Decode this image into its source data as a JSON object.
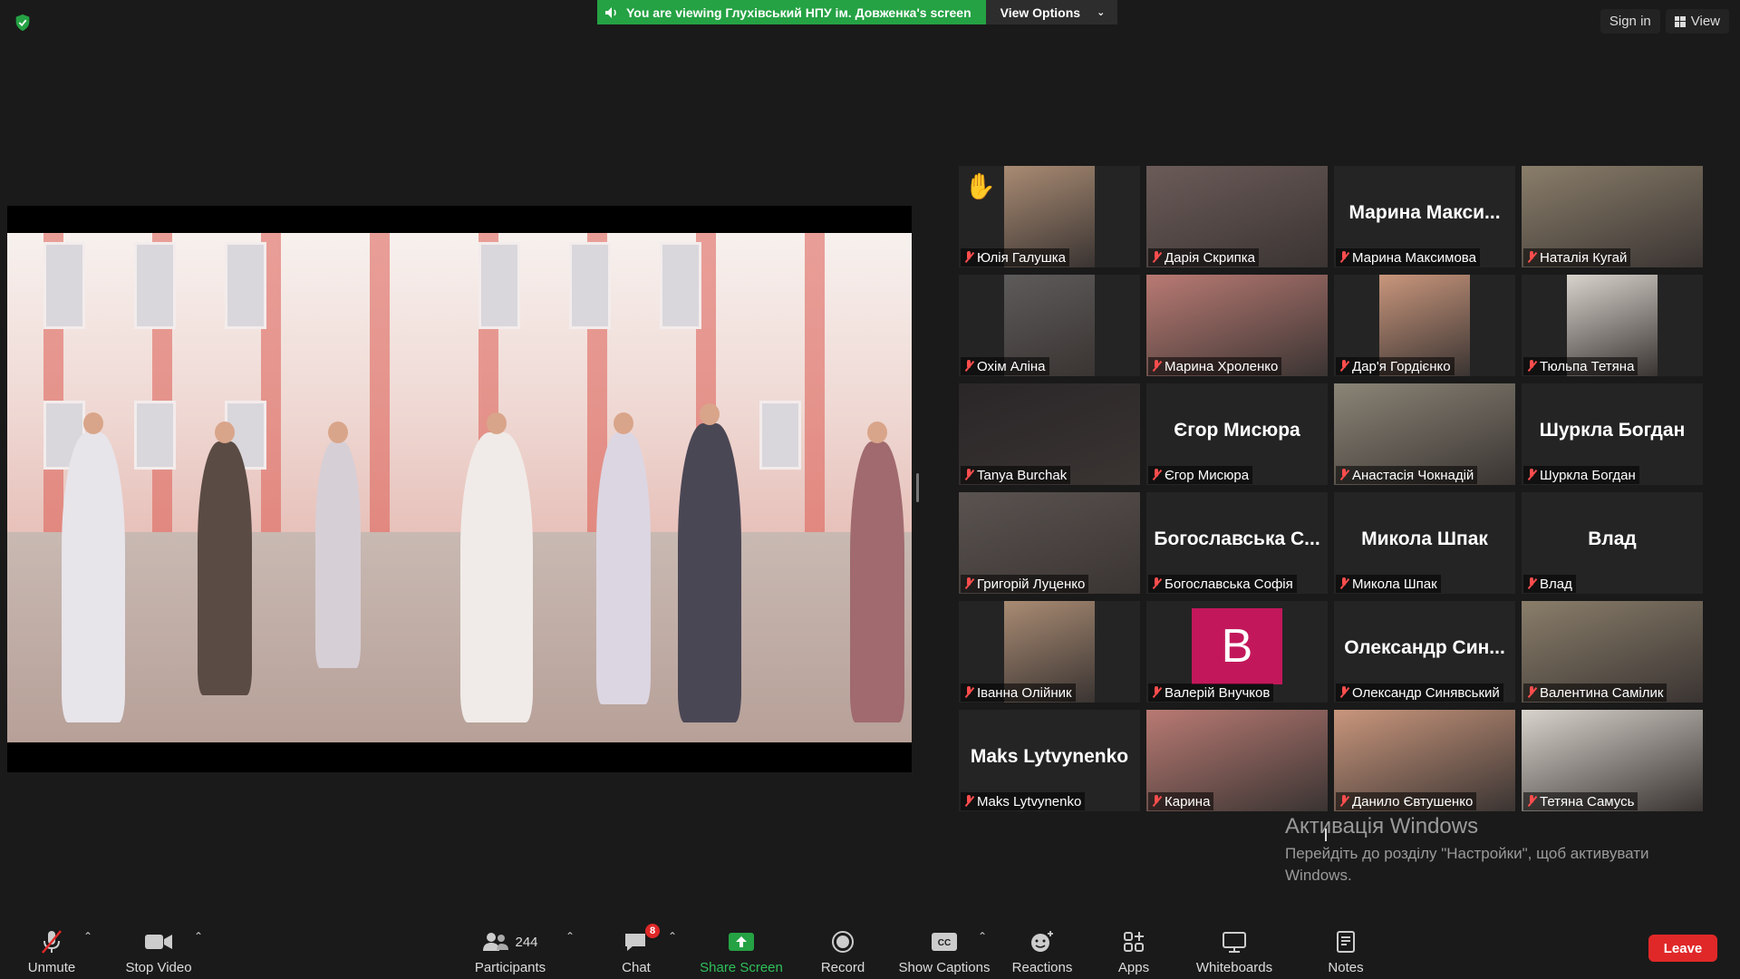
{
  "banner": {
    "text": "You are viewing Глухівський НПУ ім. Довженка's screen",
    "view_options": "View Options"
  },
  "top_right": {
    "sign_in": "Sign in",
    "view": "View"
  },
  "participants": [
    {
      "name": "Юлія Галушка",
      "big": "",
      "hand": true
    },
    {
      "name": "Дарія Скрипка",
      "big": ""
    },
    {
      "name": "Марина Максимова",
      "big": "Марина Макси..."
    },
    {
      "name": "Наталія Кугай",
      "big": ""
    },
    {
      "name": "Охім Аліна",
      "big": ""
    },
    {
      "name": "Марина Хроленко",
      "big": ""
    },
    {
      "name": "Дар'я Гордієнко",
      "big": ""
    },
    {
      "name": "Тюльпа Тетяна",
      "big": ""
    },
    {
      "name": "Tanya Burchak",
      "big": "",
      "active": true
    },
    {
      "name": "Єгор Мисюра",
      "big": "Єгор Мисюра"
    },
    {
      "name": "Анастасія Чокнадій",
      "big": ""
    },
    {
      "name": "Шуркла Богдан",
      "big": "Шуркла Богдан"
    },
    {
      "name": "Григорій Луценко",
      "big": ""
    },
    {
      "name": "Богославська Софія",
      "big": "Богославська С..."
    },
    {
      "name": "Микола Шпак",
      "big": "Микола Шпак"
    },
    {
      "name": "Влад",
      "big": "Влад"
    },
    {
      "name": "Іванна Олійник",
      "big": ""
    },
    {
      "name": "Валерій Внучков",
      "big": "",
      "avatar_letter": "B"
    },
    {
      "name": "Олександр Синявський",
      "big": "Олександр Син..."
    },
    {
      "name": "Валентина Самілик",
      "big": ""
    },
    {
      "name": "Maks Lytvynenko",
      "big": "Maks Lytvynenko"
    },
    {
      "name": "Карина",
      "big": ""
    },
    {
      "name": "Данило Євтушенко",
      "big": ""
    },
    {
      "name": "Тетяна Самусь",
      "big": ""
    }
  ],
  "activation": {
    "title": "Активація Windows",
    "text": "Перейдіть до розділу \"Настройки\", щоб активувати Windows."
  },
  "toolbar": {
    "unmute": "Unmute",
    "stop_video": "Stop Video",
    "participants": "Participants",
    "participants_count": "244",
    "chat": "Chat",
    "chat_badge": "8",
    "share_screen": "Share Screen",
    "record": "Record",
    "show_captions": "Show Captions",
    "reactions": "Reactions",
    "apps": "Apps",
    "whiteboards": "Whiteboards",
    "notes": "Notes",
    "leave": "Leave"
  },
  "colors": {
    "share_green": "#25a244",
    "leave_red": "#e02828",
    "active_outline": "#c6e66a",
    "avatar_pink": "#c2185b"
  }
}
